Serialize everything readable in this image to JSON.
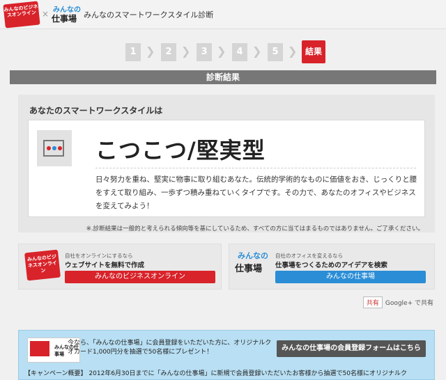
{
  "header": {
    "logo_biz_text": "みんなのビジネスオンライン",
    "separator": "×",
    "logo_shigoto_top": "みんなの",
    "logo_shigoto_bottom": "仕事場",
    "title": "みんなのスマートワークスタイル診断"
  },
  "steps": {
    "items": [
      "1",
      "2",
      "3",
      "4",
      "5"
    ],
    "chevron": "❯",
    "result_label": "結果"
  },
  "result_bar": "診断結果",
  "result": {
    "heading": "あなたのスマートワークスタイルは",
    "type_title": "こつこつ/堅実型",
    "description": "日々努力を重ね、堅実に物事に取り組むあなた。伝統的学術的なものに価値をおき、じっくりと腰をすえて取り組み、一歩ずつ積み重ねていくタイプです。その力で、あなたのオフィスやビジネスを変えてみよう！",
    "icon_colors": [
      "#d8232a",
      "#2a8dd6",
      "#777777"
    ]
  },
  "disclaimer": "※.診断結果は一般的と考えられる傾向等を基にしているため、すべての方に当てはまるものではありません。ご了承ください。",
  "promo_left": {
    "logo_text": "みんなのビジネスオンライン",
    "small": "自社をオンラインにするなら",
    "main": "ウェブサイトを無料で作成",
    "button": "みんなのビジネスオンライン"
  },
  "promo_right": {
    "logo_top": "みんなの",
    "logo_bottom": "仕事場",
    "small": "自社のオフィスを変えるなら",
    "main": "仕事場をつくるためのアイデアを検索",
    "button": "みんなの仕事場"
  },
  "share": {
    "button": "共有",
    "text": "Google+ で共有"
  },
  "campaign": {
    "thumb_text": "みんなの仕事場",
    "text": "今なら、「みんなの仕事場」に会員登録をいただいた方に、オリジナルクオカード1,000円分を抽選で50名様にプレゼント！",
    "button": "みんなの仕事場の会員登録フォームはこちら",
    "detail": "【キャンペーン概要】 2012年6月30日までに「みんなの仕事場」に新規で会員登録いただいたお客様から抽選で50名様にオリジナルク"
  },
  "colors": {
    "brand_red": "#d8232a",
    "brand_blue": "#2a8dd6",
    "bar_gray": "#777777",
    "campaign_bg": "#b8dff3"
  }
}
